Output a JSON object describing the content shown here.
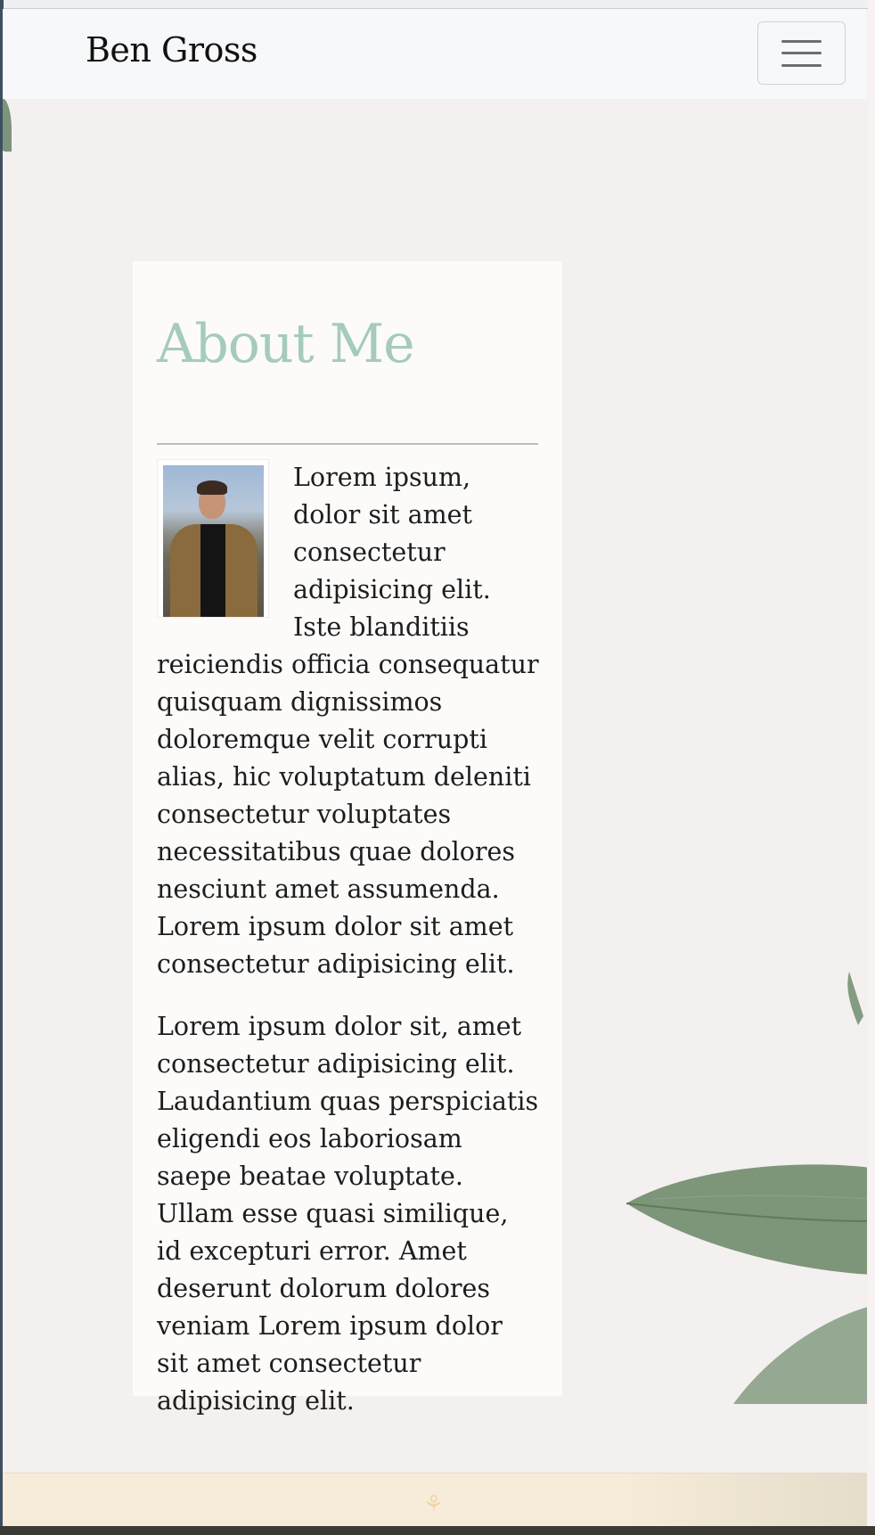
{
  "navbar": {
    "brand": "Ben Gross",
    "toggle_icon": "hamburger-menu-icon"
  },
  "about": {
    "title": "About Me",
    "avatar_alt": "portrait photo",
    "paragraphs": [
      "Lorem ipsum, dolor sit amet consectetur adipisicing elit. Iste blanditiis reiciendis officia consequatur quisquam dignissimos doloremque velit corrupti alias, hic voluptatum deleniti consectetur voluptates necessitatibus quae dolores nesciunt amet assumenda. Lorem ipsum dolor sit amet consectetur adipisicing elit.",
      "Lorem ipsum dolor sit, amet consectetur adipisicing elit. Laudantium quas perspiciatis eligendi eos laboriosam saepe beatae voluptate. Ullam esse quasi similique, id excepturi error. Amet deserunt dolorum dolores veniam Lorem ipsum dolor sit amet consectetur adipisicing elit."
    ]
  },
  "footer": {
    "icon": "leaf-icon",
    "icon_glyph": "⚘"
  },
  "colors": {
    "title_accent": "#a5cbbd",
    "page_background": "#f3f0ef",
    "card_background": "#fcfbfa",
    "footer_background": "#f6ecd9"
  }
}
